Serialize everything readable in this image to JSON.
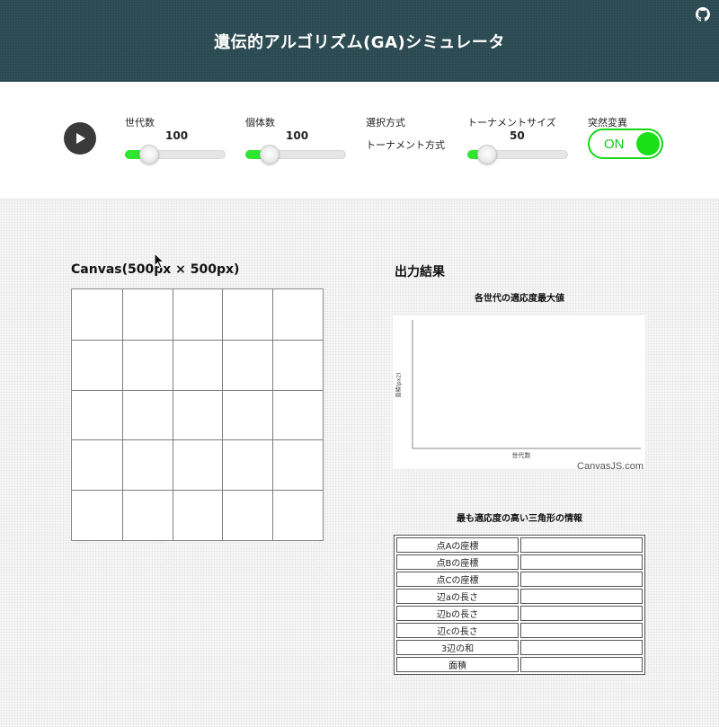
{
  "header": {
    "title": "遺伝的アルゴリズム(GA)シミュレータ",
    "icon": "github-icon"
  },
  "controls": {
    "play_icon": "play-icon",
    "generations": {
      "label": "世代数",
      "value": "100",
      "level": 0.15
    },
    "population": {
      "label": "個体数",
      "value": "100",
      "level": 0.15
    },
    "selection": {
      "label": "選択方式",
      "value": "トーナメント方式"
    },
    "tournament_size": {
      "label": "トーナメントサイズ",
      "value": "50",
      "level": 0.1
    },
    "mutation": {
      "label": "突然変異",
      "state": "ON"
    }
  },
  "canvas_section": {
    "title": "Canvas(500px × 500px)",
    "grid": {
      "rows": 5,
      "cols": 5
    }
  },
  "output": {
    "title": "出力結果",
    "chart_title": "各世代の適応度最大値",
    "credit": "CanvasJS.com",
    "table_title": "最も適応度の高い三角形の情報",
    "rows": [
      {
        "label": "点Aの座標",
        "value": ""
      },
      {
        "label": "点Bの座標",
        "value": ""
      },
      {
        "label": "点Cの座標",
        "value": ""
      },
      {
        "label": "辺aの長さ",
        "value": ""
      },
      {
        "label": "辺bの長さ",
        "value": ""
      },
      {
        "label": "辺cの長さ",
        "value": ""
      },
      {
        "label": "3辺の和",
        "value": ""
      },
      {
        "label": "面積",
        "value": ""
      }
    ]
  },
  "chart_data": {
    "type": "line",
    "title": "各世代の適応度最大値",
    "xlabel": "世代数",
    "ylabel": "面積(px2)",
    "series": []
  },
  "colors": {
    "header_bg": "#2c4a52",
    "accent_green": "#2ee62e"
  }
}
